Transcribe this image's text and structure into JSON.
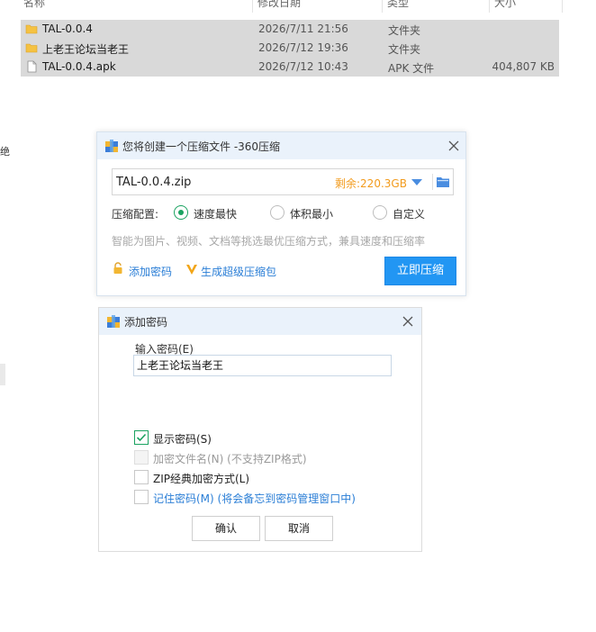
{
  "explorer": {
    "columns": [
      "名称",
      "修改日期",
      "类型",
      "大小"
    ],
    "files": [
      {
        "name": "TAL-0.0.4",
        "date": "2026/7/11 21:56",
        "type": "文件夹",
        "size": "",
        "icon": "folder-icon"
      },
      {
        "name": "上老王论坛当老王",
        "date": "2026/7/12 19:36",
        "type": "文件夹",
        "size": "",
        "icon": "folder-icon"
      },
      {
        "name": "TAL-0.0.4.apk",
        "date": "2026/7/12 10:43",
        "type": "APK 文件",
        "size": "404,807 KB",
        "icon": "file-icon"
      }
    ],
    "left_edge_text": "绝"
  },
  "compress_dialog": {
    "title": "您将创建一个压缩文件 -360压缩",
    "filename": "TAL-0.0.4.zip",
    "remaining": "剩余:220.3GB",
    "config_label": "压缩配置:",
    "options": [
      {
        "label": "速度最快",
        "selected": true
      },
      {
        "label": "体积最小",
        "selected": false
      },
      {
        "label": "自定义",
        "selected": false
      }
    ],
    "hint": "智能为图片、视频、文档等挑选最优压缩方式，兼具速度和压缩率",
    "add_password": "添加密码",
    "super_package": "生成超级压缩包",
    "compress_button": "立即压缩",
    "accent_color": "#2296f3",
    "remain_color": "#f29b1d"
  },
  "password_dialog": {
    "title": "添加密码",
    "input_label": "输入密码(E)",
    "password_value": "上老王论坛当老王",
    "show_password": "显示密码(S)",
    "encrypt_filename": "加密文件名(N) (不支持ZIP格式)",
    "zip_classic": "ZIP经典加密方式(L)",
    "remember_password": "记住密码(M) (将会备忘到密码管理窗口中)",
    "checks": {
      "show_password": true,
      "encrypt_filename": false,
      "zip_classic": false,
      "remember_password": false
    },
    "ok_button": "确认",
    "cancel_button": "取消"
  }
}
